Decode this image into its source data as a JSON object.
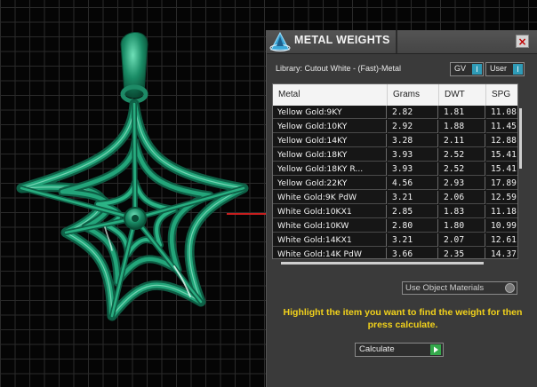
{
  "panel": {
    "title": "METAL WEIGHTS",
    "close_icon": "×",
    "library_label": "Library: Cutout White - (Fast)-Metal",
    "toggles": [
      {
        "label": "GV",
        "indicator": "I"
      },
      {
        "label": "User",
        "indicator": "I"
      }
    ],
    "table": {
      "columns": [
        "Metal",
        "Grams",
        "DWT",
        "SPG"
      ],
      "rows": [
        [
          "Yellow Gold:9KY",
          "2.82",
          "1.81",
          "11.08"
        ],
        [
          "Yellow Gold:10KY",
          "2.92",
          "1.88",
          "11.45"
        ],
        [
          "Yellow Gold:14KY",
          "3.28",
          "2.11",
          "12.88"
        ],
        [
          "Yellow Gold:18KY",
          "3.93",
          "2.52",
          "15.41"
        ],
        [
          "Yellow Gold:18KY R...",
          "3.93",
          "2.52",
          "15.41"
        ],
        [
          "Yellow Gold:22KY",
          "4.56",
          "2.93",
          "17.89"
        ],
        [
          "White Gold:9K PdW",
          "3.21",
          "2.06",
          "12.59"
        ],
        [
          "White Gold:10KX1",
          "2.85",
          "1.83",
          "11.18"
        ],
        [
          "White Gold:10KW",
          "2.80",
          "1.80",
          "10.99"
        ],
        [
          "White Gold:14KX1",
          "3.21",
          "2.07",
          "12.61"
        ],
        [
          "White Gold:14K PdW",
          "3.66",
          "2.35",
          "14.37"
        ]
      ]
    },
    "materials_select": "Use Object Materials",
    "instruction": "Highlight the item you want to find the weight for then press calculate.",
    "calculate_label": "Calculate"
  },
  "icons": {
    "logo": "app-logo-icon",
    "close": "close-icon",
    "play": "play-icon",
    "knob": "radio-knob-icon"
  },
  "colors": {
    "accent_teal": "#2f9bb7",
    "instruction_yellow": "#f2d21b",
    "pendant_green": "#1d8a66",
    "axis_red": "#c81e1e",
    "play_green": "#34a84b"
  }
}
